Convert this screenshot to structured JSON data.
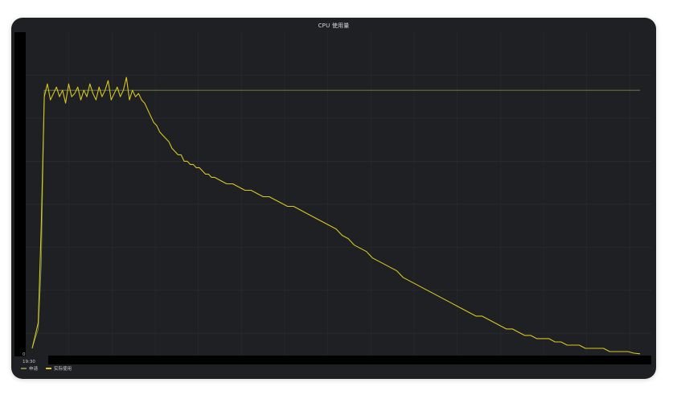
{
  "panel": {
    "title": "CPU 使用量"
  },
  "chart_data": {
    "type": "line",
    "title": "CPU 使用量",
    "xlabel": "",
    "ylabel": "",
    "y_tick_labels": [
      "0"
    ],
    "x_tick_labels": [
      "19:30"
    ],
    "grid": true,
    "legend_position": "bottom-left",
    "ylim": [
      0,
      100
    ],
    "x": [
      0,
      2,
      3,
      4,
      5,
      6,
      7,
      8,
      9,
      10,
      11,
      12,
      13,
      14,
      15,
      16,
      17,
      18,
      19,
      20,
      21,
      22,
      23,
      24,
      25,
      26,
      27,
      28,
      29,
      30,
      31,
      32,
      33,
      34,
      35,
      36,
      37,
      38,
      39,
      40,
      41,
      42,
      43,
      44,
      45,
      46,
      47,
      48,
      49,
      50,
      51,
      52,
      53,
      54,
      55,
      56,
      57,
      58,
      59,
      60,
      62,
      64,
      66,
      68,
      70,
      72,
      74,
      76,
      78,
      80,
      82,
      84,
      86,
      88,
      90,
      92,
      94,
      96,
      98,
      100,
      102,
      104,
      106,
      108,
      110,
      112,
      114,
      116,
      118,
      120,
      122,
      124,
      126,
      128,
      130,
      132,
      134,
      136,
      138,
      140,
      142,
      144,
      146,
      148,
      150,
      152,
      154,
      156,
      158,
      160,
      162,
      164,
      166,
      168,
      170,
      172,
      174,
      176,
      178,
      180,
      182,
      184,
      186,
      188,
      190,
      192,
      194,
      196,
      198,
      200
    ],
    "series": [
      {
        "name": "申请",
        "color": "#6f8a4a",
        "values": [
          2,
          8,
          28,
          82,
          82,
          82,
          82,
          82,
          82,
          82,
          82,
          82,
          82,
          82,
          82,
          82,
          82,
          82,
          82,
          82,
          82,
          82,
          82,
          82,
          82,
          82,
          82,
          82,
          82,
          82,
          82,
          82,
          82,
          82,
          82,
          82,
          82,
          82,
          82,
          82,
          82,
          82,
          82,
          82,
          82,
          82,
          82,
          82,
          82,
          82,
          82,
          82,
          82,
          82,
          82,
          82,
          82,
          82,
          82,
          82,
          82,
          82,
          82,
          82,
          82,
          82,
          82,
          82,
          82,
          82,
          82,
          82,
          82,
          82,
          82,
          82,
          82,
          82,
          82,
          82,
          82,
          82,
          82,
          82,
          82,
          82,
          82,
          82,
          82,
          82,
          82,
          82,
          82,
          82,
          82,
          82,
          82,
          82,
          82,
          82,
          82,
          82,
          82,
          82,
          82,
          82,
          82,
          82,
          82,
          82,
          82,
          82,
          82,
          82,
          82,
          82,
          82,
          82,
          82,
          82,
          82,
          82,
          82,
          82,
          82,
          82,
          82,
          82,
          82,
          82
        ]
      },
      {
        "name": "实际使用",
        "color": "#d8c820",
        "values": [
          2,
          10,
          40,
          80,
          84,
          79,
          81,
          83,
          80,
          82,
          78,
          84,
          80,
          81,
          83,
          79,
          82,
          80,
          84,
          81,
          79,
          83,
          80,
          82,
          85,
          79,
          81,
          83,
          80,
          82,
          86,
          79,
          82,
          80,
          81,
          79,
          78,
          76,
          74,
          72,
          71,
          69,
          68,
          67,
          66,
          64,
          63,
          62,
          62,
          60,
          60,
          59,
          59,
          58,
          58,
          57,
          56,
          56,
          55,
          55,
          54,
          53,
          53,
          52,
          51,
          51,
          50,
          49,
          49,
          48,
          47,
          46,
          46,
          45,
          44,
          43,
          42,
          41,
          40,
          39,
          37,
          36,
          34,
          33,
          32,
          30,
          29,
          28,
          27,
          26,
          24,
          23,
          22,
          21,
          20,
          19,
          18,
          17,
          16,
          15,
          14,
          13,
          12,
          12,
          11,
          10,
          9,
          8,
          8,
          7,
          6,
          6,
          5,
          5,
          5,
          4,
          4,
          3,
          3,
          3,
          2,
          2,
          2,
          2,
          1,
          1,
          1,
          1,
          0.5,
          0.3
        ]
      }
    ]
  }
}
